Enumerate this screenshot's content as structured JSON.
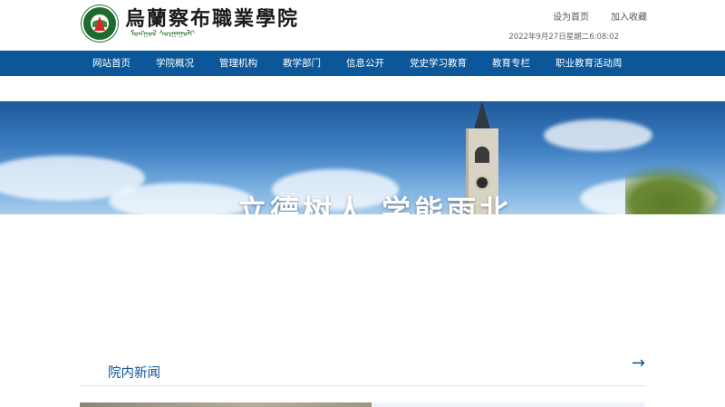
{
  "header": {
    "logo_title": "烏蘭察布職業學院",
    "logo_script": "ᠮᠣᠩᠭᠣᠯ ᠰᠤᠷᠭᠠᠭᠤᠯᠢ",
    "top_links": [
      "设为首页",
      "加入收藏"
    ],
    "datetime": "2022年9月27日星期二6:08:02"
  },
  "nav": {
    "items": [
      "网站首页",
      "学院概况",
      "管理机构",
      "教学部门",
      "信息公开",
      "党史学习教育",
      "教育专栏",
      "职业教育活动周"
    ]
  },
  "banner": {
    "slogan": "立德树人 学能雨北"
  },
  "news": {
    "title": "院内新闻",
    "more_icon": "→"
  },
  "colors": {
    "nav_bg": "#0b5799",
    "accent": "#0b5799"
  }
}
